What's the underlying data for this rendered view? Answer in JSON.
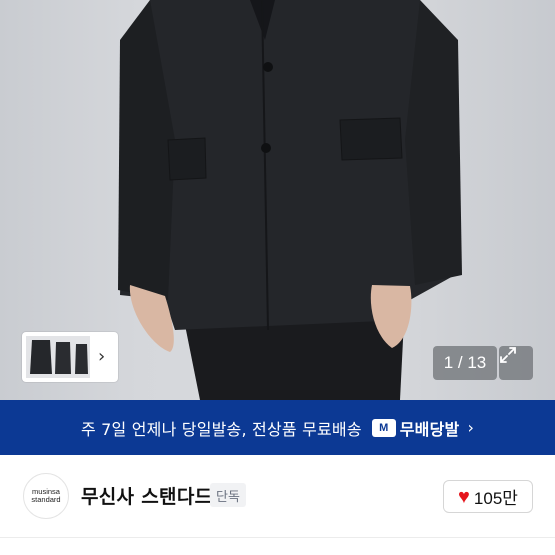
{
  "gallery": {
    "counter": "1 / 13",
    "thumb_chevron": "›",
    "image_alt": "black suit jacket product photo"
  },
  "banner": {
    "text": "주 7일 언제나 당일발송, 전상품 무료배송",
    "badge_icon": "M",
    "badge_label": "무배당발",
    "arrow": "›"
  },
  "brand": {
    "logo_line1": "musinsa",
    "logo_line2": "standard",
    "name": "무신사 스탠다드",
    "tag": "단독"
  },
  "like": {
    "count": "105만",
    "icon": "♥"
  },
  "colors": {
    "banner_bg": "#0c3994",
    "heart": "#e5161d"
  }
}
